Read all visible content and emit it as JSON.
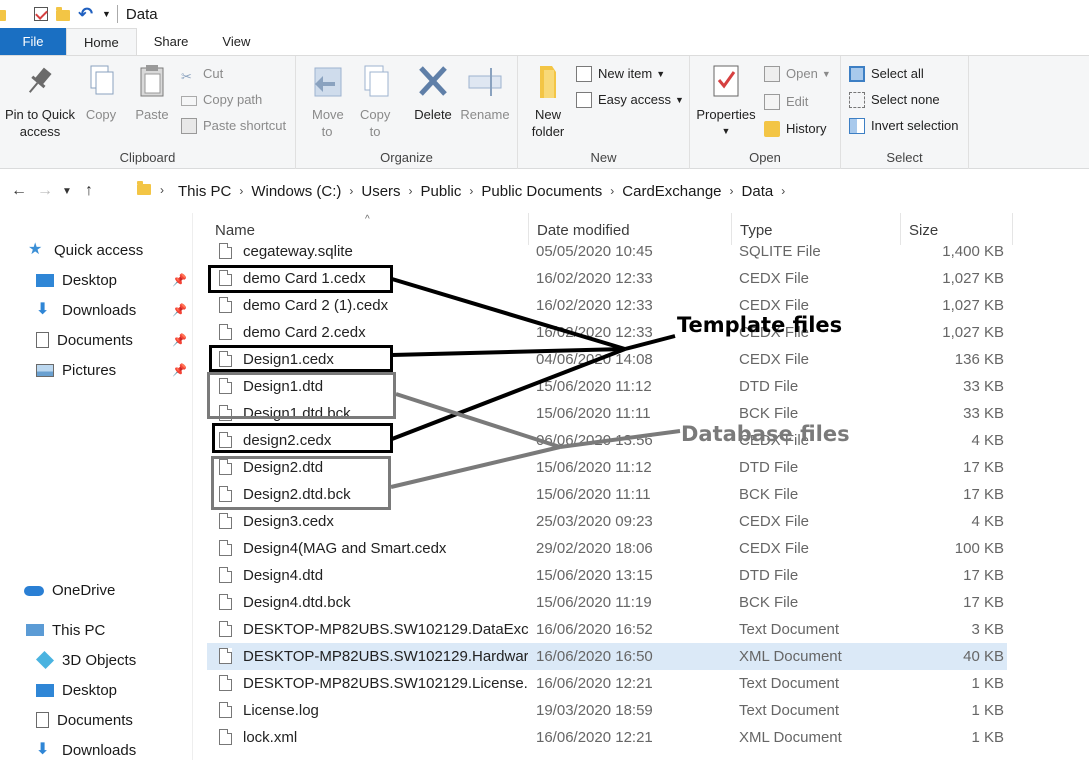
{
  "window": {
    "title": "Data"
  },
  "tabs": {
    "file": "File",
    "home": "Home",
    "share": "Share",
    "view": "View"
  },
  "ribbon": {
    "clipboard": {
      "label": "Clipboard",
      "pin": "Pin to Quick access",
      "copy": "Copy",
      "paste": "Paste",
      "cut": "Cut",
      "copy_path": "Copy path",
      "paste_shortcut": "Paste shortcut"
    },
    "organize": {
      "label": "Organize",
      "move_to": "Move to",
      "copy_to": "Copy to",
      "delete": "Delete",
      "rename": "Rename"
    },
    "new": {
      "label": "New",
      "new_folder": "New folder",
      "new_item": "New item",
      "easy_access": "Easy access"
    },
    "open": {
      "label": "Open",
      "properties": "Properties",
      "open": "Open",
      "edit": "Edit",
      "history": "History"
    },
    "select": {
      "label": "Select",
      "select_all": "Select all",
      "select_none": "Select none",
      "invert": "Invert selection"
    }
  },
  "breadcrumb": [
    "This PC",
    "Windows (C:)",
    "Users",
    "Public",
    "Public Documents",
    "CardExchange",
    "Data"
  ],
  "nav": {
    "quick_access": "Quick access",
    "qa_items": [
      "Desktop",
      "Downloads",
      "Documents",
      "Pictures"
    ],
    "onedrive": "OneDrive",
    "this_pc": "This PC",
    "pc_items": [
      "3D Objects",
      "Desktop",
      "Documents",
      "Downloads"
    ]
  },
  "columns": {
    "name": "Name",
    "date": "Date modified",
    "type": "Type",
    "size": "Size"
  },
  "files": [
    {
      "name": "cegateway.sqlite",
      "date": "05/05/2020 10:45",
      "type": "SQLITE File",
      "size": "1,400 KB"
    },
    {
      "name": "demo Card 1.cedx",
      "date": "16/02/2020 12:33",
      "type": "CEDX File",
      "size": "1,027 KB"
    },
    {
      "name": "demo Card 2 (1).cedx",
      "date": "16/02/2020 12:33",
      "type": "CEDX File",
      "size": "1,027 KB"
    },
    {
      "name": "demo Card 2.cedx",
      "date": "16/02/2020 12:33",
      "type": "CEDX File",
      "size": "1,027 KB"
    },
    {
      "name": "Design1.cedx",
      "date": "04/06/2020 14:08",
      "type": "CEDX File",
      "size": "136 KB"
    },
    {
      "name": "Design1.dtd",
      "date": "15/06/2020 11:12",
      "type": "DTD File",
      "size": "33 KB"
    },
    {
      "name": "Design1.dtd.bck",
      "date": "15/06/2020 11:11",
      "type": "BCK File",
      "size": "33 KB"
    },
    {
      "name": "design2.cedx",
      "date": "06/06/2020 13:56",
      "type": "CEDX File",
      "size": "4 KB"
    },
    {
      "name": "Design2.dtd",
      "date": "15/06/2020 11:12",
      "type": "DTD File",
      "size": "17 KB"
    },
    {
      "name": "Design2.dtd.bck",
      "date": "15/06/2020 11:11",
      "type": "BCK File",
      "size": "17 KB"
    },
    {
      "name": "Design3.cedx",
      "date": "25/03/2020 09:23",
      "type": "CEDX File",
      "size": "4 KB"
    },
    {
      "name": "Design4(MAG and Smart.cedx",
      "date": "29/02/2020 18:06",
      "type": "CEDX File",
      "size": "100 KB"
    },
    {
      "name": "Design4.dtd",
      "date": "15/06/2020 13:15",
      "type": "DTD File",
      "size": "17 KB"
    },
    {
      "name": "Design4.dtd.bck",
      "date": "15/06/2020 11:19",
      "type": "BCK File",
      "size": "17 KB"
    },
    {
      "name": "DESKTOP-MP82UBS.SW102129.DataExc...",
      "date": "16/06/2020 16:52",
      "type": "Text Document",
      "size": "3 KB"
    },
    {
      "name": "DESKTOP-MP82UBS.SW102129.Hardwar...",
      "date": "16/06/2020 16:50",
      "type": "XML Document",
      "size": "40 KB",
      "selected": true
    },
    {
      "name": "DESKTOP-MP82UBS.SW102129.License.l...",
      "date": "16/06/2020 12:21",
      "type": "Text Document",
      "size": "1 KB"
    },
    {
      "name": "License.log",
      "date": "19/03/2020 18:59",
      "type": "Text Document",
      "size": "1 KB"
    },
    {
      "name": "lock.xml",
      "date": "16/06/2020 12:21",
      "type": "XML Document",
      "size": "1 KB"
    }
  ],
  "annotations": {
    "template": "Template files",
    "database": "Database files",
    "template_color": "#000000",
    "database_color": "#7a7a7a"
  }
}
